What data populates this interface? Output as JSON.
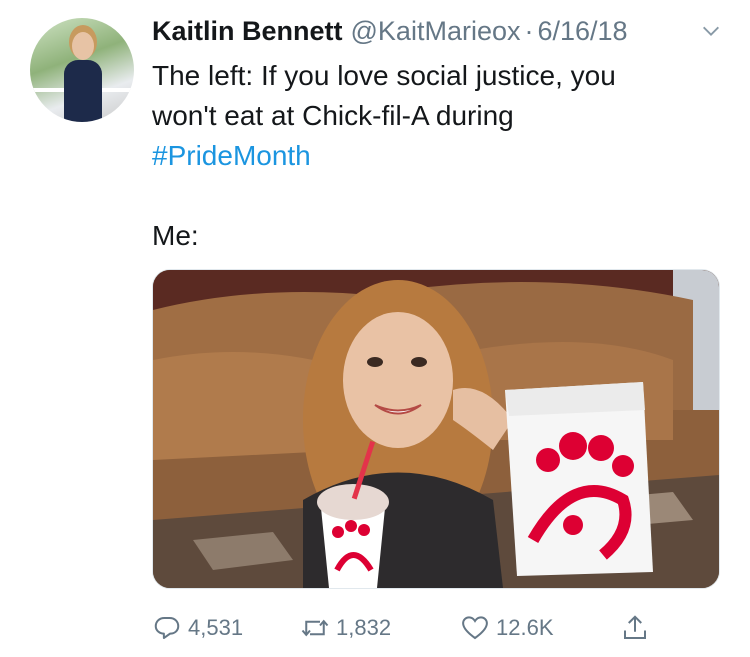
{
  "tweet": {
    "author_name": "Kaitlin Bennett",
    "handle": "@KaitMarieox",
    "separator": "·",
    "date": "6/16/18",
    "text_lines": [
      "The left: If you love social justice, you",
      "won't eat at Chick-fil-A during"
    ],
    "hashtag": "#PrideMonth",
    "me_line": "Me:"
  },
  "actions": {
    "replies": "4,531",
    "retweets": "1,832",
    "likes": "12.6K"
  },
  "icons": {
    "menu": "chevron-down-icon",
    "reply": "reply-icon",
    "retweet": "retweet-icon",
    "like": "heart-icon",
    "share": "share-icon"
  },
  "colors": {
    "text": "#14171a",
    "secondary": "#657786",
    "link": "#1b95e0",
    "brand_red": "#dd0033"
  }
}
